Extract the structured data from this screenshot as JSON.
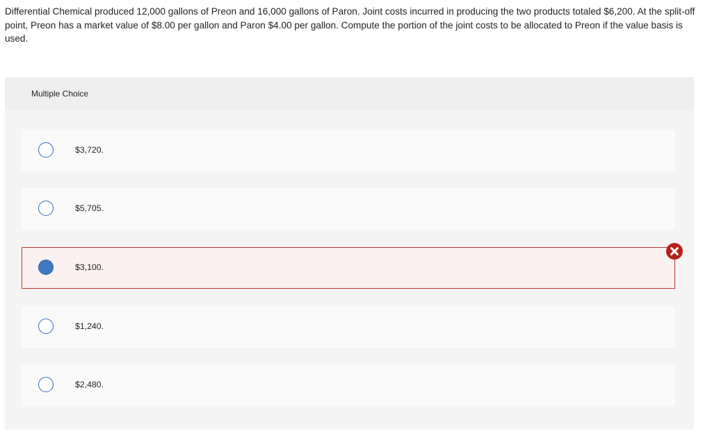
{
  "question": {
    "text": "Differential Chemical produced 12,000 gallons of Preon and 16,000 gallons of Paron. Joint costs incurred in producing the two products totaled $6,200. At the split-off point, Preon has a market value of $8.00 per gallon and Paron $4.00 per gallon. Compute the portion of the joint costs to be allocated to Preon if the value basis is used."
  },
  "multiple_choice": {
    "header": "Multiple Choice",
    "options": [
      {
        "label": "$3,720.",
        "selected": false
      },
      {
        "label": "$5,705.",
        "selected": false
      },
      {
        "label": "$3,100.",
        "selected": true,
        "result": "incorrect"
      },
      {
        "label": "$1,240.",
        "selected": false
      },
      {
        "label": "$2,480.",
        "selected": false
      }
    ]
  },
  "colors": {
    "radio_outline": "#2b6bbf",
    "radio_selected_fill": "#3f78c4",
    "incorrect_border": "#b6362e",
    "incorrect_icon": "#b5221b",
    "panel_bg": "#f4f4f4",
    "option_bg": "#fafafa"
  },
  "icons": {
    "incorrect": "x-circle-icon",
    "radio": "radio-button-icon"
  }
}
